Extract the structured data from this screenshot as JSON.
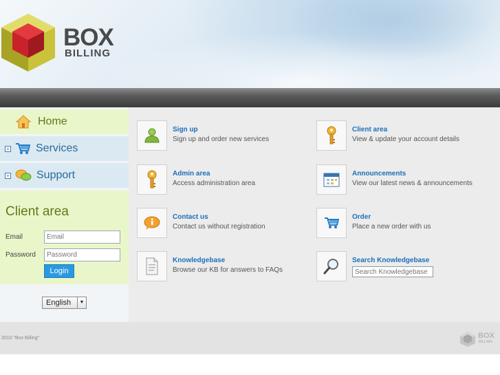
{
  "brand": {
    "word1": "BOX",
    "word2": "BILLING"
  },
  "nav": {
    "home": "Home",
    "services": "Services",
    "support": "Support",
    "expand_symbol": "+"
  },
  "client_area": {
    "title": "Client area",
    "email_label": "Email",
    "email_placeholder": "Email",
    "password_label": "Password",
    "password_placeholder": "Password",
    "login_label": "Login"
  },
  "language": {
    "selected": "English",
    "arrow": "▼"
  },
  "tiles": [
    {
      "title": "Sign up",
      "desc": "Sign up and order new services",
      "icon": "users-icon"
    },
    {
      "title": "Client area",
      "desc": "View & update your account details",
      "icon": "key-icon"
    },
    {
      "title": "Admin area",
      "desc": "Access administration area",
      "icon": "key-icon"
    },
    {
      "title": "Announcements",
      "desc": "View our latest news & announcements",
      "icon": "calendar-icon"
    },
    {
      "title": "Contact us",
      "desc": "Contact us without registration",
      "icon": "info-bubble-icon"
    },
    {
      "title": "Order",
      "desc": "Place a new order with us",
      "icon": "cart-icon"
    },
    {
      "title": "Knowledgebase",
      "desc": "Browse our KB for answers to FAQs",
      "icon": "document-icon"
    },
    {
      "title": "Search Knowledgebase",
      "search_placeholder": "Search Knowledgebase",
      "icon": "magnifier-icon"
    }
  ],
  "footer": {
    "copyright": "2010 \"Box Billing\"",
    "logo_word1": "BOX",
    "logo_word2": "BILLING"
  },
  "colors": {
    "accent_green": "#5f7a1a",
    "link_blue": "#1d6fb8",
    "button_blue": "#2a9ae0"
  }
}
